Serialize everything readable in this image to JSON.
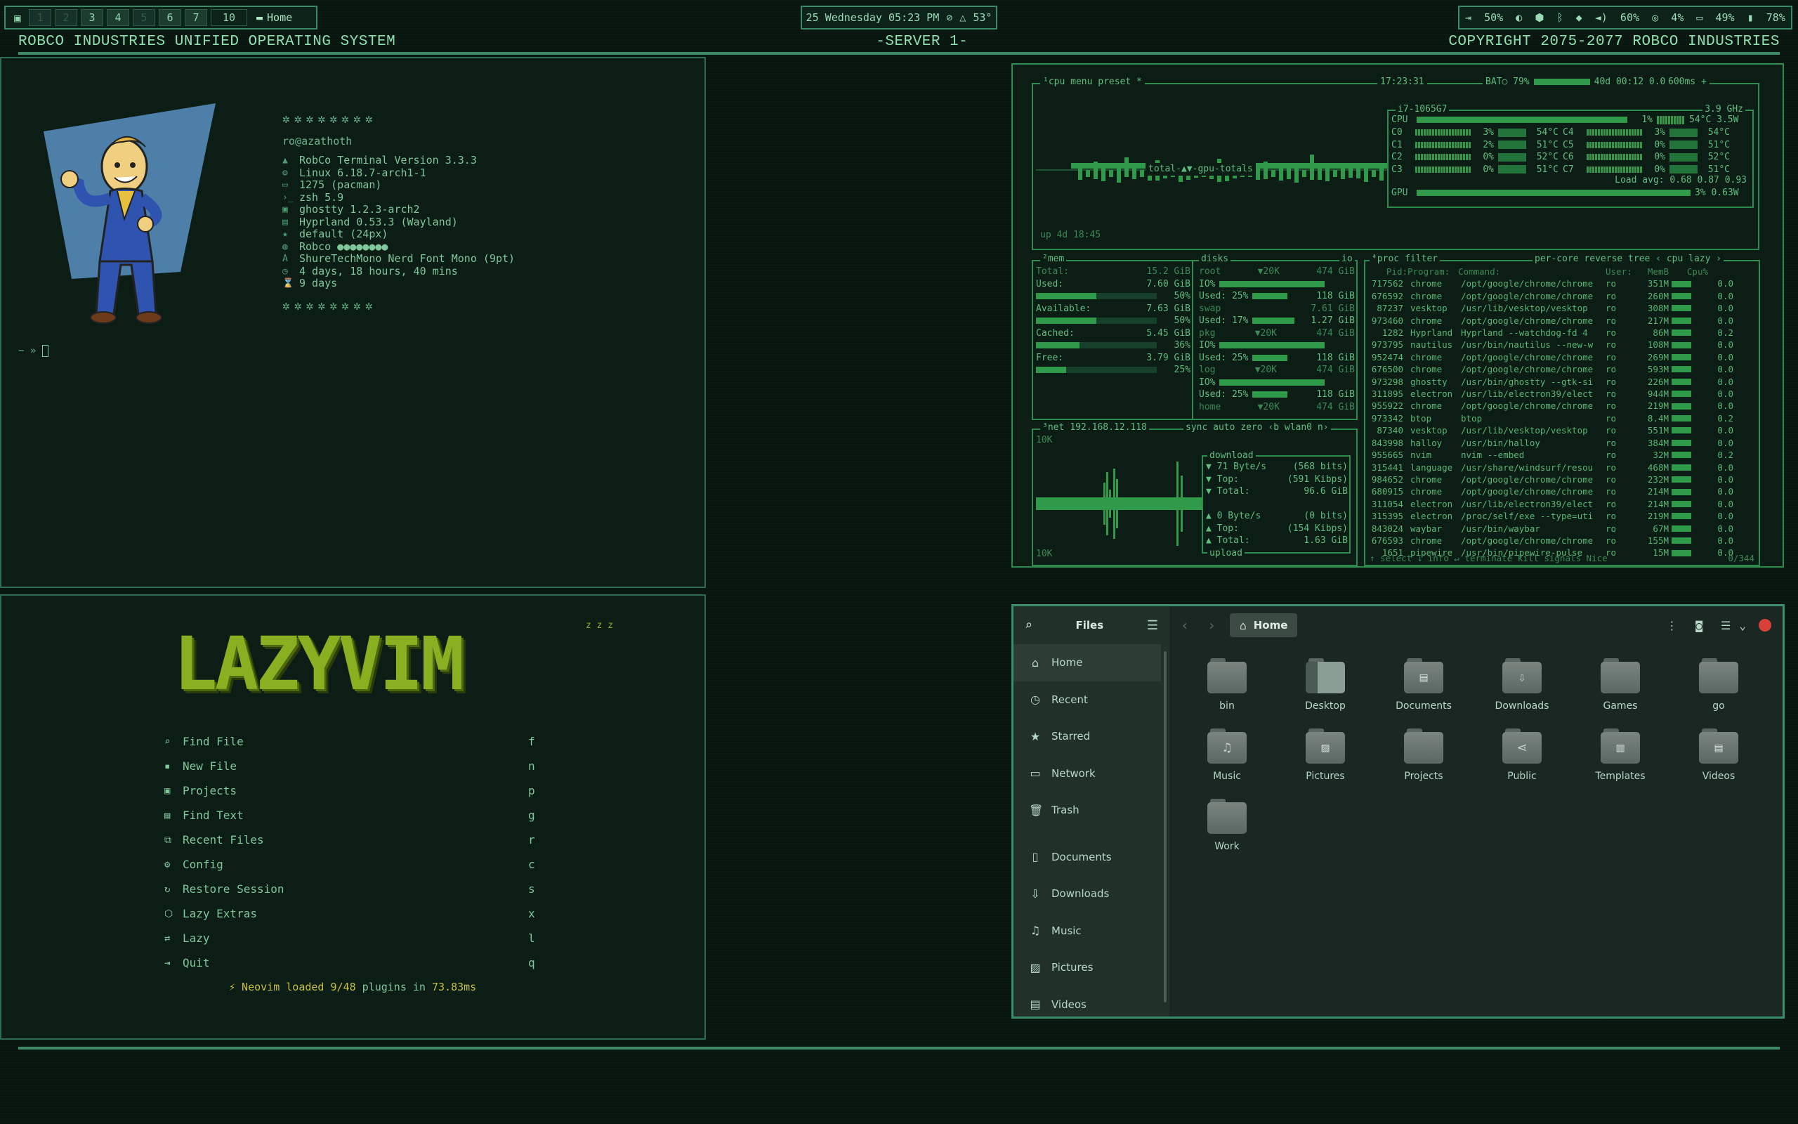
{
  "topbar": {
    "workspaces": [
      "1",
      "2",
      "3",
      "4",
      "5",
      "6",
      "7"
    ],
    "workspace_extra": "10",
    "home_label": "Home",
    "clock": "25 Wednesday 05:23 PM",
    "temp": "53°",
    "volume_left": "50%",
    "volume": "60%",
    "cpu": "4%",
    "mem": "49%",
    "battery": "78%"
  },
  "header": {
    "left": "ROBCO INDUSTRIES UNIFIED OPERATING SYSTEM",
    "center": "-SERVER 1-",
    "right": "COPYRIGHT 2075-2077 ROBCO INDUSTRIES"
  },
  "fastfetch": {
    "userhost": "ro@azathoth",
    "lines": [
      "RobCo Terminal Version 3.3.3",
      "Linux 6.18.7-arch1-1",
      "1275 (pacman)",
      "zsh 5.9",
      "ghostty 1.2.3-arch2",
      "Hyprland 0.53.3 (Wayland)",
      "default (24px)",
      "Robco ●●●●●●●●",
      "ShureTechMono Nerd Font Mono (9pt)",
      "4 days, 18 hours, 40 mins",
      "9 days"
    ],
    "prompt": "~ »"
  },
  "btop": {
    "cpu_header": "¹cpu  menu preset *",
    "time": "17:23:31",
    "bat": "BAT○ 79%",
    "bat_time": "40d 00:12 0.05W",
    "ms": "600ms +",
    "cpu_model": "i7-1065G7",
    "freq": "3.9 GHz",
    "cpu_label": "CPU",
    "cpu_pct": "1%",
    "cpu_temp": "54°C 3.5W",
    "cores": [
      {
        "name": "C0",
        "pct": "3%",
        "temp": "54°C",
        "name2": "C4",
        "pct2": "3%",
        "temp2": "54°C"
      },
      {
        "name": "C1",
        "pct": "2%",
        "temp": "51°C",
        "name2": "C5",
        "pct2": "0%",
        "temp2": "51°C"
      },
      {
        "name": "C2",
        "pct": "0%",
        "temp": "52°C",
        "name2": "C6",
        "pct2": "0%",
        "temp2": "52°C"
      },
      {
        "name": "C3",
        "pct": "0%",
        "temp": "51°C",
        "name2": "C7",
        "pct2": "0%",
        "temp2": "51°C"
      }
    ],
    "load_avg": "Load avg: 0.68 0.87 0.93",
    "gpu_label": "GPU",
    "gpu_pct": "3% 0.63W",
    "graph_label": "total-▲▼-gpu-totals",
    "uptime": "up 4d 18:45",
    "mem": {
      "title": "²mem",
      "total": "Total:",
      "total_v": "15.2 GiB",
      "rows": [
        {
          "label": "Used:",
          "value": "7.60 GiB",
          "pct": "50%"
        },
        {
          "label": "Available:",
          "value": "7.63 GiB",
          "pct": "50%"
        },
        {
          "label": "Cached:",
          "value": "5.45 GiB",
          "pct": "36%"
        },
        {
          "label": "Free:",
          "value": "3.79 GiB",
          "pct": "25%"
        }
      ]
    },
    "disks": {
      "title": "disks",
      "io": "io",
      "rows": [
        {
          "name": "root",
          "io": "▼20K",
          "total": "474 GiB",
          "l2": "IO%",
          "l3": "Used: 25%",
          "v3": "118 GiB"
        },
        {
          "name": "swap",
          "io": "",
          "total": "7.61 GiB",
          "l2": "Used: 17%",
          "v2": "1.27 GiB",
          "l3": ""
        },
        {
          "name": "pkg",
          "io": "▼20K",
          "total": "474 GiB",
          "l2": "IO%",
          "l3": "Used: 25%",
          "v3": "118 GiB"
        },
        {
          "name": "log",
          "io": "▼20K",
          "total": "474 GiB",
          "l2": "IO%",
          "l3": "Used: 25%",
          "v3": "118 GiB"
        },
        {
          "name": "home",
          "io": "▼20K",
          "total": "474 GiB",
          "l2": "",
          "l3": ""
        }
      ]
    },
    "net": {
      "title": "³net",
      "ip": "192.168.12.118",
      "opts": "sync auto zero ‹b wlan0 n›",
      "top": "10K",
      "bottom": "10K",
      "download": "download",
      "upload": "upload",
      "dl": [
        {
          "l": "▼ 71 Byte/s",
          "v": "(568 bits)"
        },
        {
          "l": "▼ Top:",
          "v": "(591 Kibps)"
        },
        {
          "l": "▼ Total:",
          "v": "96.6 GiB"
        }
      ],
      "ul": [
        {
          "l": "▲ 0 Byte/s",
          "v": "(0 bits)"
        },
        {
          "l": "▲ Top:",
          "v": "(154 Kibps)"
        },
        {
          "l": "▲ Total:",
          "v": "1.63 GiB"
        }
      ]
    },
    "proc": {
      "title": "⁴proc",
      "filter": "filter",
      "opts": "per-core reverse tree ‹ cpu lazy ›",
      "headers": [
        "Pid:",
        "Program:",
        "Command:",
        "User:",
        "MemB",
        "Cpu%"
      ],
      "rows": [
        [
          "717562",
          "chrome",
          "/opt/google/chrome/chrome",
          "ro",
          "351M",
          "0.0"
        ],
        [
          "676592",
          "chrome",
          "/opt/google/chrome/chrome",
          "ro",
          "260M",
          "0.0"
        ],
        [
          "87237",
          "vesktop",
          "/usr/lib/vesktop/vesktop",
          "ro",
          "308M",
          "0.0"
        ],
        [
          "973460",
          "chrome",
          "/opt/google/chrome/chrome",
          "ro",
          "217M",
          "0.0"
        ],
        [
          "1282",
          "Hyprland",
          "Hyprland --watchdog-fd 4",
          "ro",
          "86M",
          "0.2"
        ],
        [
          "973795",
          "nautilus",
          "/usr/bin/nautilus --new-w",
          "ro",
          "108M",
          "0.0"
        ],
        [
          "952474",
          "chrome",
          "/opt/google/chrome/chrome",
          "ro",
          "269M",
          "0.0"
        ],
        [
          "676500",
          "chrome",
          "/opt/google/chrome/chrome",
          "ro",
          "593M",
          "0.0"
        ],
        [
          "973298",
          "ghostty",
          "/usr/bin/ghostty --gtk-si",
          "ro",
          "226M",
          "0.0"
        ],
        [
          "311895",
          "electron",
          "/usr/lib/electron39/elect",
          "ro",
          "944M",
          "0.0"
        ],
        [
          "955922",
          "chrome",
          "/opt/google/chrome/chrome",
          "ro",
          "219M",
          "0.0"
        ],
        [
          "973342",
          "btop",
          "btop",
          "ro",
          "8.4M",
          "0.2"
        ],
        [
          "87340",
          "vesktop",
          "/usr/lib/vesktop/vesktop",
          "ro",
          "551M",
          "0.0"
        ],
        [
          "843998",
          "halloy",
          "/usr/bin/halloy",
          "ro",
          "384M",
          "0.0"
        ],
        [
          "955665",
          "nvim",
          "nvim --embed",
          "ro",
          "32M",
          "0.2"
        ],
        [
          "315441",
          "language",
          "/usr/share/windsurf/resou",
          "ro",
          "468M",
          "0.0"
        ],
        [
          "984652",
          "chrome",
          "/opt/google/chrome/chrome",
          "ro",
          "232M",
          "0.0"
        ],
        [
          "680915",
          "chrome",
          "/opt/google/chrome/chrome",
          "ro",
          "214M",
          "0.0"
        ],
        [
          "311054",
          "electron",
          "/usr/lib/electron39/elect",
          "ro",
          "214M",
          "0.0"
        ],
        [
          "315395",
          "electron",
          "/proc/self/exe --type=uti",
          "ro",
          "219M",
          "0.0"
        ],
        [
          "843024",
          "waybar",
          "/usr/bin/waybar",
          "ro",
          "67M",
          "0.0"
        ],
        [
          "676593",
          "chrome",
          "/opt/google/chrome/chrome",
          "ro",
          "155M",
          "0.0"
        ],
        [
          "1651",
          "pipewire",
          "/usr/bin/pipewire-pulse",
          "ro",
          "15M",
          "0.0"
        ]
      ],
      "footer": "↑ select ↓  info ↵  terminate  kill  signals  Nice",
      "count": "0/344"
    }
  },
  "lazyvim": {
    "logo": "LAZYVIM",
    "zzz": "z z z",
    "items": [
      {
        "label": "Find File",
        "key": "f",
        "icon": "search-icon",
        "glyph": "⌕"
      },
      {
        "label": "New File",
        "key": "n",
        "icon": "new-file-icon",
        "glyph": "▪"
      },
      {
        "label": "Projects",
        "key": "p",
        "icon": "projects-icon",
        "glyph": "▣"
      },
      {
        "label": "Find Text",
        "key": "g",
        "icon": "find-text-icon",
        "glyph": "▤"
      },
      {
        "label": "Recent Files",
        "key": "r",
        "icon": "recent-icon",
        "glyph": "⧉"
      },
      {
        "label": "Config",
        "key": "c",
        "icon": "gear-icon",
        "glyph": "⚙"
      },
      {
        "label": "Restore Session",
        "key": "s",
        "icon": "restore-icon",
        "glyph": "↻"
      },
      {
        "label": "Lazy Extras",
        "key": "x",
        "icon": "extras-icon",
        "glyph": "⬡"
      },
      {
        "label": "Lazy",
        "key": "l",
        "icon": "lazy-icon",
        "glyph": "⇄"
      },
      {
        "label": "Quit",
        "key": "q",
        "icon": "quit-icon",
        "glyph": "⇥"
      }
    ],
    "footer_a": "⚡ Neovim loaded ",
    "footer_b": "9/48",
    "footer_c": " plugins in ",
    "footer_d": "73.83ms"
  },
  "files": {
    "app_title": "Files",
    "path": "Home",
    "sidebar": [
      {
        "label": "Home",
        "icon": "home-icon",
        "glyph": "⌂"
      },
      {
        "label": "Recent",
        "icon": "clock-icon",
        "glyph": "◷"
      },
      {
        "label": "Starred",
        "icon": "star-icon",
        "glyph": "★"
      },
      {
        "label": "Network",
        "icon": "network-icon",
        "glyph": "▭"
      },
      {
        "label": "Trash",
        "icon": "trash-icon",
        "glyph": "🗑"
      },
      {
        "label": "Documents",
        "icon": "documents-icon",
        "glyph": "▯"
      },
      {
        "label": "Downloads",
        "icon": "download-icon",
        "glyph": "⇩"
      },
      {
        "label": "Music",
        "icon": "music-icon",
        "glyph": "♫"
      },
      {
        "label": "Pictures",
        "icon": "pictures-icon",
        "glyph": "▨"
      },
      {
        "label": "Videos",
        "icon": "videos-icon",
        "glyph": "▤"
      }
    ],
    "folders": [
      {
        "label": "bin",
        "glyph": ""
      },
      {
        "label": "Desktop",
        "glyph": ""
      },
      {
        "label": "Documents",
        "glyph": "▤"
      },
      {
        "label": "Downloads",
        "glyph": "⇩"
      },
      {
        "label": "Games",
        "glyph": ""
      },
      {
        "label": "go",
        "glyph": ""
      },
      {
        "label": "Music",
        "glyph": "♫"
      },
      {
        "label": "Pictures",
        "glyph": "▨"
      },
      {
        "label": "Projects",
        "glyph": ""
      },
      {
        "label": "Public",
        "glyph": "⋖"
      },
      {
        "label": "Templates",
        "glyph": "▥"
      },
      {
        "label": "Videos",
        "glyph": "▤"
      },
      {
        "label": "Work",
        "glyph": ""
      }
    ]
  }
}
